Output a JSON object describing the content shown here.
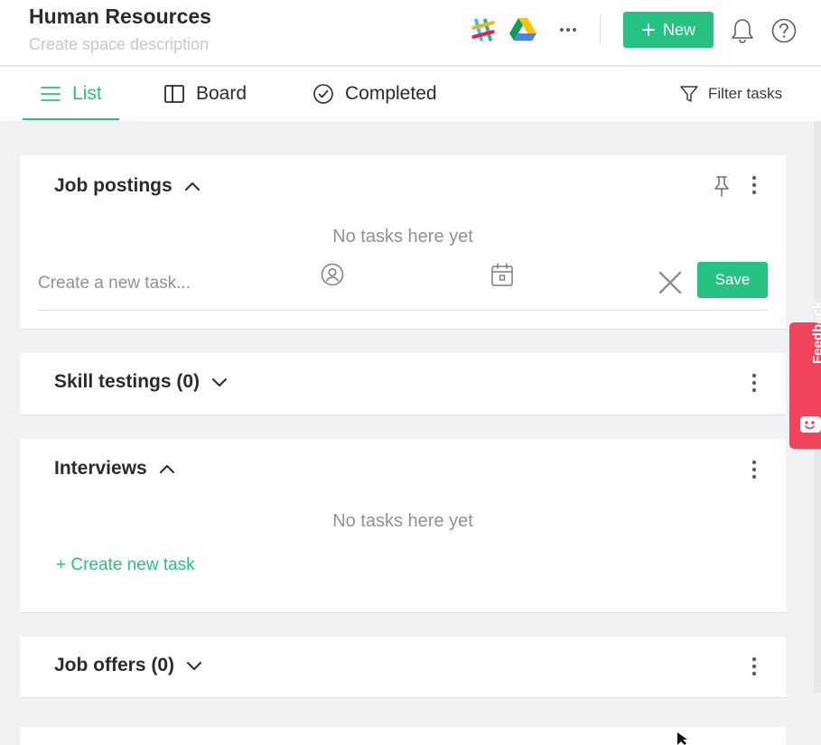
{
  "header": {
    "title": "Human Resources",
    "subtitle": "Create space description",
    "integrations": [
      "slack-icon",
      "google-drive-icon"
    ],
    "new_label": "New"
  },
  "tabs": [
    {
      "label": "List",
      "icon": "list-icon",
      "active": true
    },
    {
      "label": "Board",
      "icon": "board-icon",
      "active": false
    },
    {
      "label": "Completed",
      "icon": "check-circle-icon",
      "active": false
    }
  ],
  "filter_label": "Filter tasks",
  "sections": {
    "job_postings": {
      "title": "Job postings",
      "expanded": true,
      "empty_text": "No tasks here yet",
      "task_placeholder": "Create a new task...",
      "save_label": "Save"
    },
    "skill_testings": {
      "title": "Skill testings (0)",
      "expanded": false
    },
    "interviews": {
      "title": "Interviews",
      "expanded": true,
      "empty_text": "No tasks here yet",
      "create_label": "+ Create new task"
    },
    "job_offers": {
      "title": "Job offers (0)",
      "expanded": false
    }
  },
  "feedback_label": "Feedback",
  "colors": {
    "accent": "#26c281",
    "feedback": "#f0445a",
    "background": "#f1f2f4"
  }
}
